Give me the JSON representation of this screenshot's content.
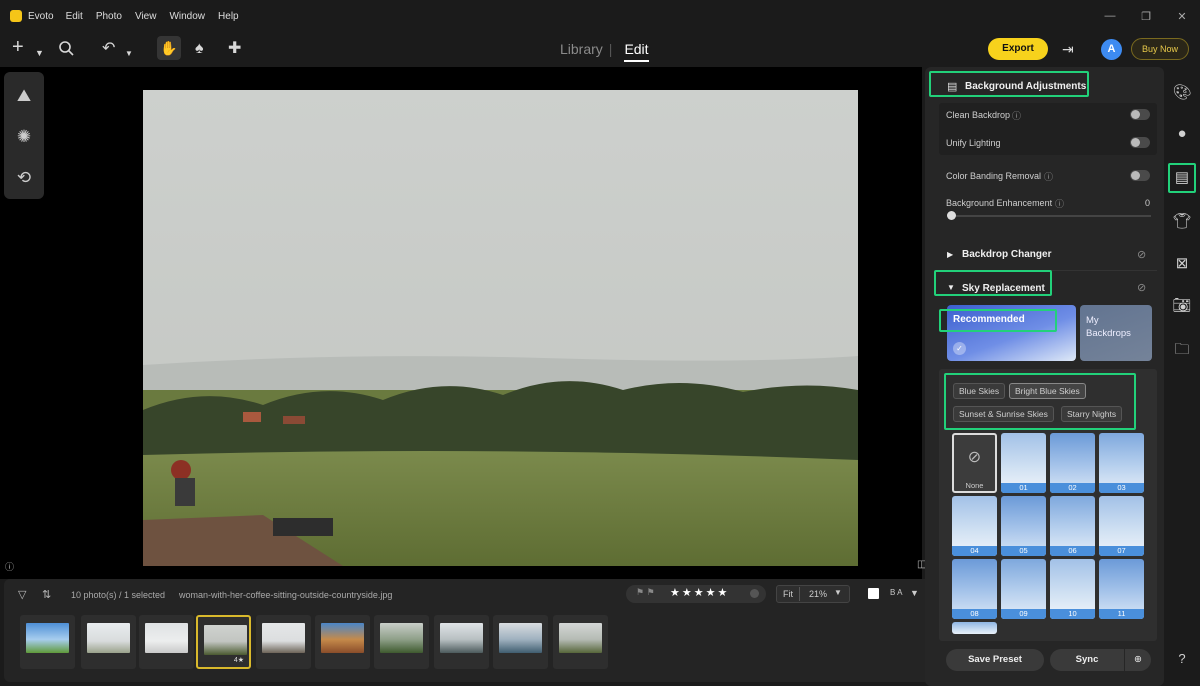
{
  "titlebar": {
    "app_name": "Evoto",
    "menu": [
      "Edit",
      "Photo",
      "View",
      "Window",
      "Help"
    ],
    "controls": {
      "minimize": "—",
      "maximize": "❐",
      "close": "✕"
    }
  },
  "toolbar": {
    "tabs": {
      "library": "Library",
      "edit": "Edit"
    },
    "export_label": "Export",
    "avatar_initial": "A",
    "buy_now_label": "Buy Now"
  },
  "filmstrip": {
    "count_label": "10 photo(s) / 1 selected",
    "filename": "woman-with-her-coffee-sitting-outside-countryside.jpg",
    "stars": "★★★★★",
    "zoom_fit": "Fit",
    "zoom_value": "21%",
    "compare_label": "B A",
    "selected_index": 3,
    "thumb_badges": [
      "",
      "",
      "",
      "4★",
      "",
      "",
      "",
      "",
      "",
      ""
    ]
  },
  "right_panel": {
    "background_adjustments": {
      "title": "Background Adjustments",
      "clean_backdrop": "Clean Backdrop",
      "unify_lighting": "Unify Lighting",
      "color_banding": "Color Banding Removal",
      "bg_enhancement": "Background Enhancement",
      "bg_enhancement_value": "0"
    },
    "backdrop_changer": "Backdrop Changer",
    "sky_replacement": {
      "title": "Sky Replacement",
      "tab_recommended": "Recommended",
      "tab_my_backdrops": "My Backdrops",
      "chips": [
        "Blue Skies",
        "Bright Blue Skies",
        "Sunset & Sunrise Skies",
        "Starry Nights"
      ],
      "presets": [
        "None",
        "01",
        "02",
        "03",
        "04",
        "05",
        "06",
        "07",
        "08",
        "09",
        "10",
        "11"
      ]
    },
    "save_preset": "Save Preset",
    "sync": "Sync"
  },
  "colors": {
    "accent_yellow": "#f7d21c",
    "highlight_green": "#22d17a",
    "avatar_blue": "#3d8bf2"
  }
}
